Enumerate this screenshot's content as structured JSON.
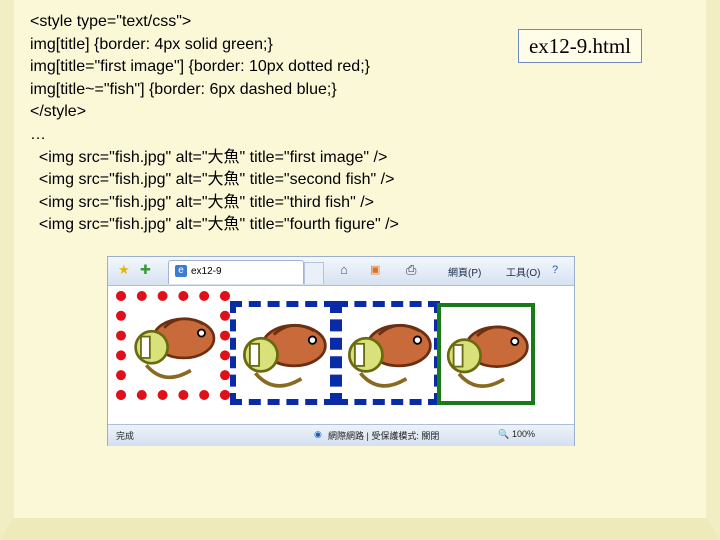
{
  "code_lines": [
    "<style type=\"text/css\">",
    "img[title] {border: 4px solid green;}",
    "img[title=\"first image\"] {border: 10px dotted red;}",
    "img[title~=\"fish\"] {border: 6px dashed blue;}",
    "</style>",
    "…",
    "  <img src=\"fish.jpg\" alt=\"大魚\" title=\"first image\" />",
    "  <img src=\"fish.jpg\" alt=\"大魚\" title=\"second fish\" />",
    "  <img src=\"fish.jpg\" alt=\"大魚\" title=\"third fish\" />",
    "  <img src=\"fish.jpg\" alt=\"大魚\" title=\"fourth figure\" />"
  ],
  "filename": "ex12-9.html",
  "browser": {
    "tab_label": "ex12-9",
    "commands": [
      "網頁(P)",
      "工具(O)"
    ],
    "status_left": "完成",
    "status_mid": "網際網路 | 受保護模式: 關閉",
    "zoom": "100%"
  },
  "images": [
    {
      "title": "first image",
      "alt": "大魚",
      "border": "10px dotted red"
    },
    {
      "title": "second fish",
      "alt": "大魚",
      "border": "6px dashed blue"
    },
    {
      "title": "third fish",
      "alt": "大魚",
      "border": "6px dashed blue"
    },
    {
      "title": "fourth figure",
      "alt": "大魚",
      "border": "4px solid green"
    }
  ],
  "colors": {
    "red": "#e0101a",
    "blue": "#0a2ba8",
    "green": "#1a7a1a",
    "background": "#fbf8d8"
  }
}
